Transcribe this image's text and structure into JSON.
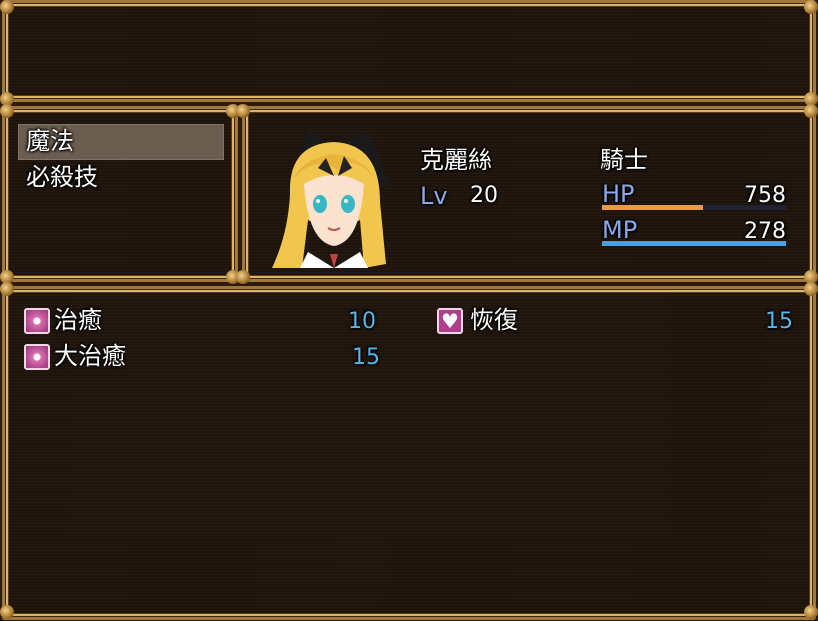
{
  "help_window": {
    "text": ""
  },
  "command_menu": {
    "items": [
      {
        "label": "魔法",
        "selected": true
      },
      {
        "label": "必殺技",
        "selected": false
      }
    ]
  },
  "status": {
    "name": "克麗絲",
    "class": "騎士",
    "level_label": "Lv",
    "level": "20",
    "hp_label": "HP",
    "hp": "758",
    "hp_ratio": 0.55,
    "mp_label": "MP",
    "mp": "278",
    "mp_ratio": 1.0,
    "colors": {
      "hp_gauge": "#e89a4a",
      "mp_gauge": "#4aa0e0",
      "system_text": "#8aa8ea",
      "cost_text": "#57b6ea"
    }
  },
  "skills": [
    {
      "icon": "heal-sparkle-icon",
      "name": "治癒",
      "cost": "10"
    },
    {
      "icon": "heart-icon",
      "name": "恢復",
      "cost": "15"
    },
    {
      "icon": "heal-sparkle-icon",
      "name": "大治癒",
      "cost": "15"
    }
  ]
}
